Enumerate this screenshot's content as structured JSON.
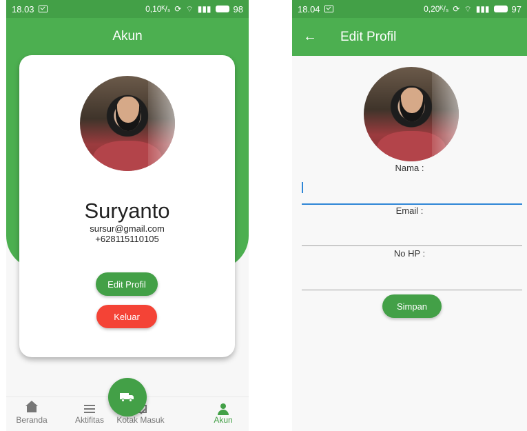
{
  "left_screen": {
    "status_bar": {
      "time": "18.03",
      "network": "0,10",
      "battery": "98"
    },
    "app_bar": {
      "title": "Akun"
    },
    "profile": {
      "name": "Suryanto",
      "email": "sursur@gmail.com",
      "phone": "+628115110105"
    },
    "buttons": {
      "edit": "Edit Profil",
      "logout": "Keluar"
    },
    "bottom_nav": {
      "items": [
        {
          "label": "Beranda",
          "icon": "home-icon"
        },
        {
          "label": "Aktifitas",
          "icon": "menu-icon"
        },
        {
          "label": "Kotak Masuk",
          "icon": "mail-icon"
        },
        {
          "label": "Akun",
          "icon": "user-icon"
        }
      ],
      "fab_icon": "truck-icon"
    }
  },
  "right_screen": {
    "status_bar": {
      "time": "18.04",
      "network": "0,20",
      "battery": "97"
    },
    "app_bar": {
      "title": "Edit Profil",
      "back_icon": "arrow-left-icon"
    },
    "form": {
      "name_label": "Nama :",
      "email_label": "Email :",
      "phone_label": "No HP :",
      "save_label": "Simpan"
    }
  },
  "colors": {
    "primary": "#4caf50",
    "primary_dark": "#43a047",
    "danger": "#f44336",
    "focus": "#2f86d6"
  }
}
